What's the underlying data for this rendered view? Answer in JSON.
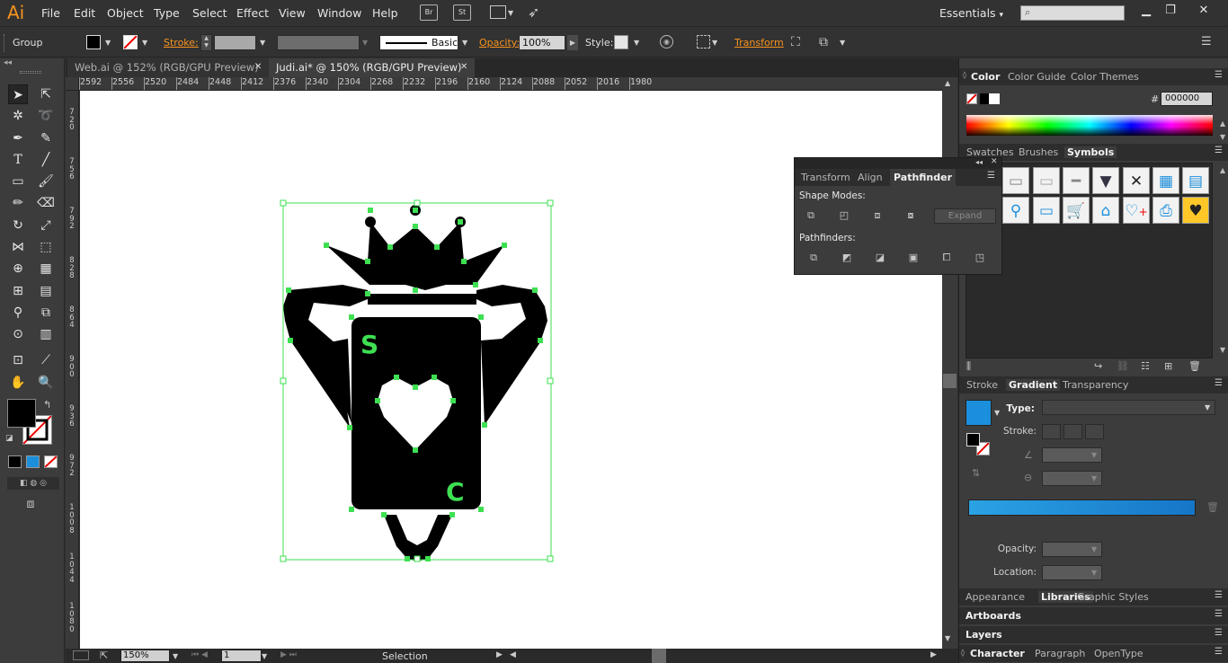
{
  "app": {
    "logo": "Ai"
  },
  "menu": [
    "File",
    "Edit",
    "Object",
    "Type",
    "Select",
    "Effect",
    "View",
    "Window",
    "Help"
  ],
  "menubar_icons": {
    "bridge": "Br",
    "stock": "St"
  },
  "workspace": {
    "label": "Essentials",
    "arrow": "▾"
  },
  "window_controls": {
    "minimize": "▁",
    "maximize": "❐",
    "close": "✕"
  },
  "control": {
    "selection_label": "Group",
    "stroke_label": "Stroke:",
    "brush_label": "Basic",
    "opacity_label": "Opacity:",
    "opacity_value": "100%",
    "style_label": "Style:",
    "transform_label": "Transform"
  },
  "tabs": [
    {
      "label": "Web.ai @ 152% (RGB/GPU Preview)",
      "close": "✕"
    },
    {
      "label": "Judi.ai* @ 150% (RGB/GPU Preview)",
      "close": "✕"
    }
  ],
  "ruler": {
    "h": [
      "2592",
      "2556",
      "2520",
      "2484",
      "2448",
      "2412",
      "2376",
      "2340",
      "2304",
      "2268",
      "2232",
      "2196",
      "2160",
      "2124",
      "2088",
      "2052",
      "2016",
      "1980"
    ],
    "v": [
      "7\n2\n0",
      "7\n5\n6",
      "7\n9\n2",
      "8\n2\n8",
      "8\n6\n4",
      "9\n0\n0",
      "9\n3\n6",
      "9\n7\n2",
      "1\n0\n0\n8",
      "1\n0\n4\n4",
      "1\n0\n8\n0"
    ]
  },
  "artwork": {
    "letter_top": "S",
    "letter_bottom": "C"
  },
  "status": {
    "zoom": "150%",
    "artboard": "1",
    "mode": "Selection"
  },
  "panels": {
    "color": {
      "tabs": [
        "Color",
        "Color Guide",
        "Color Themes"
      ],
      "hex_label": "#",
      "hex_value": "000000"
    },
    "symbols": {
      "tabs": [
        "Swatches",
        "Brushes",
        "Symbols"
      ]
    },
    "pathfinder": {
      "tabs": [
        "Transform",
        "Align",
        "Pathfinder"
      ],
      "shape_modes_label": "Shape Modes:",
      "expand_label": "Expand",
      "pathfinders_label": "Pathfinders:"
    },
    "gradient": {
      "tabs": [
        "Stroke",
        "Gradient",
        "Transparency"
      ],
      "type_label": "Type:",
      "stroke_label": "Stroke:",
      "opacity_label": "Opacity:",
      "location_label": "Location:"
    },
    "bottom_tabs": [
      "Appearance",
      "Libraries",
      "Graphic Styles"
    ],
    "artboards": "Artboards",
    "layers": "Layers",
    "char_tabs": [
      "Character",
      "Paragraph",
      "OpenType"
    ]
  },
  "colors": {
    "accent_orange": "#f7931e",
    "selection_green": "#3ee052",
    "gradient_blue": "#1b8fdc"
  }
}
